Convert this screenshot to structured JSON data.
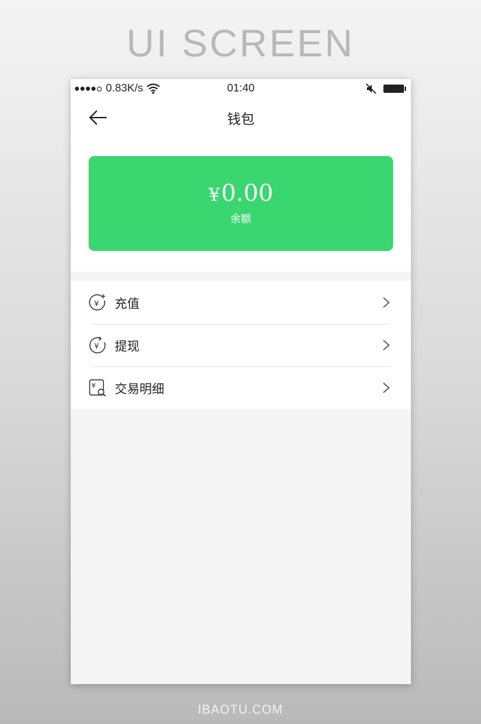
{
  "hero_title": "UI SCREEN",
  "status_bar": {
    "speed": "0.83K/s",
    "time": "01:40"
  },
  "nav": {
    "title": "钱包",
    "back_icon": "arrow-left-icon"
  },
  "wallet": {
    "currency_symbol": "¥",
    "balance": "0.00",
    "balance_label": "余额",
    "card_color": "#3ad670"
  },
  "menu": {
    "items": [
      {
        "label": "充值",
        "icon": "yen-plus-icon"
      },
      {
        "label": "提现",
        "icon": "yen-withdraw-icon"
      },
      {
        "label": "交易明细",
        "icon": "transaction-details-icon"
      }
    ]
  },
  "footer": "IBAOTU.COM"
}
